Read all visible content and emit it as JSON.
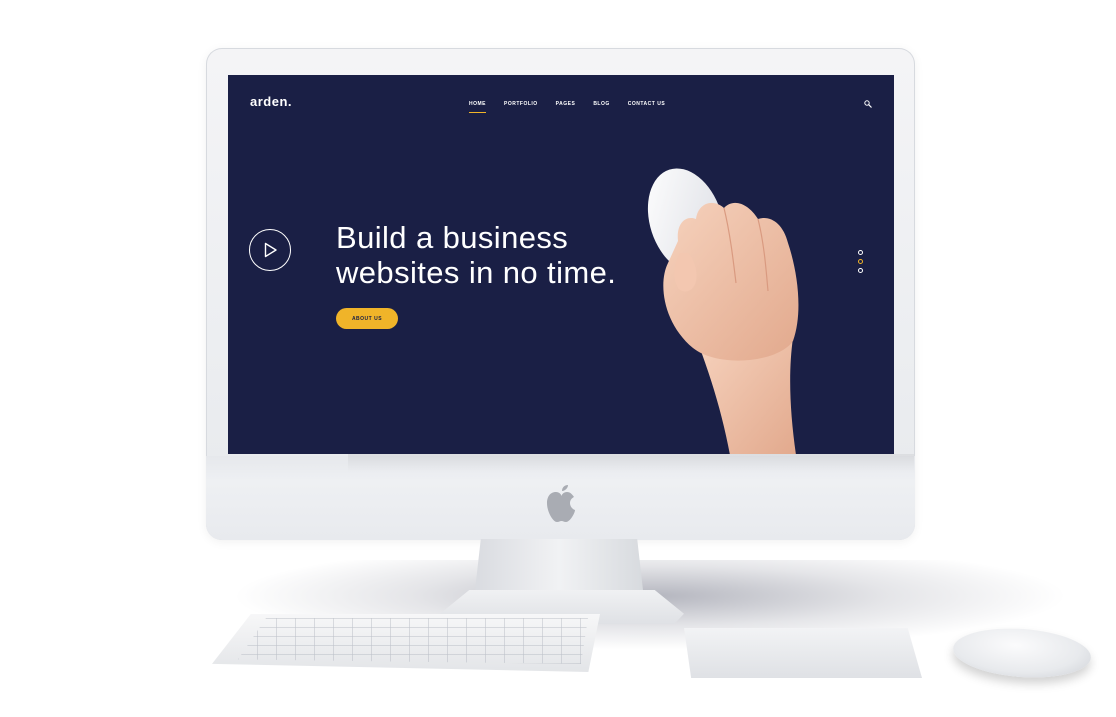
{
  "site": {
    "logo": "arden.",
    "nav": [
      {
        "label": "HOME",
        "active": true
      },
      {
        "label": "PORTFOLIO",
        "active": false
      },
      {
        "label": "PAGES",
        "active": false
      },
      {
        "label": "BLOG",
        "active": false
      },
      {
        "label": "CONTACT US",
        "active": false
      }
    ],
    "search_icon": "search-icon"
  },
  "hero": {
    "headline_line1": "Build a business",
    "headline_line2": "websites in no time.",
    "cta_label": "ABOUT US",
    "play_icon": "play-icon",
    "slider": {
      "count": 3,
      "active_index": 1
    }
  },
  "colors": {
    "background": "#1a1f45",
    "accent": "#f0b429",
    "text": "#ffffff"
  }
}
